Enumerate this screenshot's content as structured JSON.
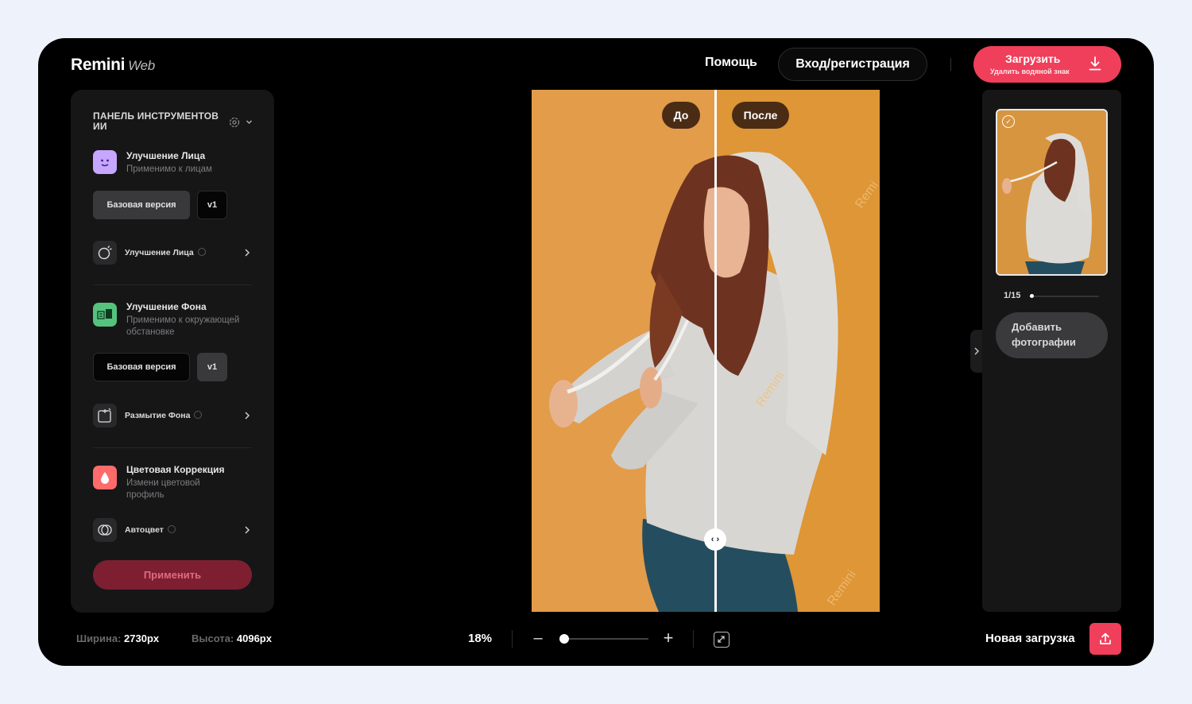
{
  "header": {
    "logo": "Remini",
    "logo_suffix": "Web",
    "help": "Помощь",
    "login": "Вход/регистрация",
    "download_label": "Загрузить",
    "download_sub": "Удалить водяной знак"
  },
  "tools": {
    "title": "ПАНЕЛЬ ИНСТРУМЕНТОВ ИИ",
    "face": {
      "title": "Улучшение Лица",
      "subtitle": "Применимо к лицам",
      "version_base": "Базовая версия",
      "version_v1": "v1",
      "option": "Улучшение Лица"
    },
    "background": {
      "title": "Улучшение Фона",
      "subtitle": "Применимо к окружающей обстановке",
      "version_base": "Базовая версия",
      "version_v1": "v1",
      "option": "Размытие Фона"
    },
    "color": {
      "title": "Цветовая Коррекция",
      "subtitle": "Измени цветовой профиль",
      "option": "Автоцвет"
    },
    "apply": "Применить"
  },
  "compare": {
    "before": "До",
    "after": "После"
  },
  "gallery": {
    "counter": "1/15",
    "progress_fraction": 0.067,
    "add_photos": "Добавить фотографии"
  },
  "footer": {
    "width_label": "Ширина:",
    "width_value": "2730px",
    "height_label": "Высота:",
    "height_value": "4096px",
    "zoom": "18%",
    "new_upload": "Новая загрузка"
  },
  "colors": {
    "accent": "#ef3f5a",
    "photo_bg": "#df9a46",
    "app_bg": "#000000"
  }
}
